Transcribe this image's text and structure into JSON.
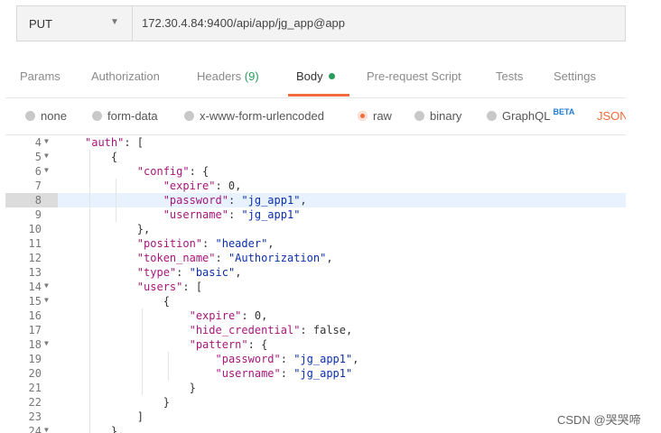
{
  "request": {
    "method": "PUT",
    "url": "172.30.4.84:9400/api/app/jg_app@app"
  },
  "tabs": [
    {
      "label": "Params"
    },
    {
      "label": "Authorization"
    },
    {
      "label": "Headers",
      "count": "(9)"
    },
    {
      "label": "Body",
      "active": true
    },
    {
      "label": "Pre-request Script"
    },
    {
      "label": "Tests"
    },
    {
      "label": "Settings"
    }
  ],
  "body_types": [
    {
      "label": "none",
      "checked": false
    },
    {
      "label": "form-data",
      "checked": false
    },
    {
      "label": "x-www-form-urlencoded",
      "checked": false
    },
    {
      "label": "raw",
      "checked": true
    },
    {
      "label": "binary",
      "checked": false
    },
    {
      "label": "GraphQL",
      "checked": false,
      "badge": "BETA"
    },
    {
      "label": "JSON"
    }
  ],
  "editor": {
    "highlighted_line": "8",
    "lines": [
      {
        "n": "4",
        "fold": "▼",
        "indent": 0,
        "parts": [
          [
            "k",
            "\"auth\""
          ],
          [
            "p",
            ": ["
          ]
        ]
      },
      {
        "n": "5",
        "fold": "▼",
        "indent": 1,
        "parts": [
          [
            "p",
            "{"
          ]
        ]
      },
      {
        "n": "6",
        "fold": "▼",
        "indent": 2,
        "parts": [
          [
            "k",
            "\"config\""
          ],
          [
            "p",
            ": {"
          ]
        ]
      },
      {
        "n": "7",
        "fold": "",
        "indent": 3,
        "parts": [
          [
            "k",
            "\"expire\""
          ],
          [
            "p",
            ": 0,"
          ]
        ]
      },
      {
        "n": "8",
        "fold": "",
        "indent": 3,
        "parts": [
          [
            "k",
            "\"password\""
          ],
          [
            "p",
            ": "
          ],
          [
            "s",
            "\"jg_app1\""
          ],
          [
            "p",
            ","
          ]
        ]
      },
      {
        "n": "9",
        "fold": "",
        "indent": 3,
        "parts": [
          [
            "k",
            "\"username\""
          ],
          [
            "p",
            ": "
          ],
          [
            "s",
            "\"jg_app1\""
          ]
        ]
      },
      {
        "n": "10",
        "fold": "",
        "indent": 2,
        "parts": [
          [
            "p",
            "},"
          ]
        ]
      },
      {
        "n": "11",
        "fold": "",
        "indent": 2,
        "parts": [
          [
            "k",
            "\"position\""
          ],
          [
            "p",
            ": "
          ],
          [
            "s",
            "\"header\""
          ],
          [
            "p",
            ","
          ]
        ]
      },
      {
        "n": "12",
        "fold": "",
        "indent": 2,
        "parts": [
          [
            "k",
            "\"token_name\""
          ],
          [
            "p",
            ": "
          ],
          [
            "s",
            "\"Authorization\""
          ],
          [
            "p",
            ","
          ]
        ]
      },
      {
        "n": "13",
        "fold": "",
        "indent": 2,
        "parts": [
          [
            "k",
            "\"type\""
          ],
          [
            "p",
            ": "
          ],
          [
            "s",
            "\"basic\""
          ],
          [
            "p",
            ","
          ]
        ]
      },
      {
        "n": "14",
        "fold": "▼",
        "indent": 2,
        "parts": [
          [
            "k",
            "\"users\""
          ],
          [
            "p",
            ": ["
          ]
        ]
      },
      {
        "n": "15",
        "fold": "▼",
        "indent": 3,
        "parts": [
          [
            "p",
            "{"
          ]
        ]
      },
      {
        "n": "16",
        "fold": "",
        "indent": 4,
        "parts": [
          [
            "k",
            "\"expire\""
          ],
          [
            "p",
            ": 0,"
          ]
        ]
      },
      {
        "n": "17",
        "fold": "",
        "indent": 4,
        "parts": [
          [
            "k",
            "\"hide_credential\""
          ],
          [
            "p",
            ": false,"
          ]
        ]
      },
      {
        "n": "18",
        "fold": "▼",
        "indent": 4,
        "parts": [
          [
            "k",
            "\"pattern\""
          ],
          [
            "p",
            ": {"
          ]
        ]
      },
      {
        "n": "19",
        "fold": "",
        "indent": 5,
        "parts": [
          [
            "k",
            "\"password\""
          ],
          [
            "p",
            ": "
          ],
          [
            "s",
            "\"jg_app1\""
          ],
          [
            "p",
            ","
          ]
        ]
      },
      {
        "n": "20",
        "fold": "",
        "indent": 5,
        "parts": [
          [
            "k",
            "\"username\""
          ],
          [
            "p",
            ": "
          ],
          [
            "s",
            "\"jg_app1\""
          ]
        ]
      },
      {
        "n": "21",
        "fold": "",
        "indent": 4,
        "parts": [
          [
            "p",
            "}"
          ]
        ]
      },
      {
        "n": "22",
        "fold": "",
        "indent": 3,
        "parts": [
          [
            "p",
            "}"
          ]
        ]
      },
      {
        "n": "23",
        "fold": "",
        "indent": 2,
        "parts": [
          [
            "p",
            "]"
          ]
        ]
      },
      {
        "n": "24",
        "fold": "▼",
        "indent": 1,
        "parts": [
          [
            "p",
            "},"
          ]
        ]
      }
    ]
  },
  "watermark": "CSDN @哭哭啼",
  "colors": {
    "accent": "#f26b3a",
    "green": "#2a9d5c",
    "key": "#a7167b",
    "string": "#0b2fa8",
    "highlight": "#e8f2ff",
    "beta": "#1f7bd6"
  }
}
